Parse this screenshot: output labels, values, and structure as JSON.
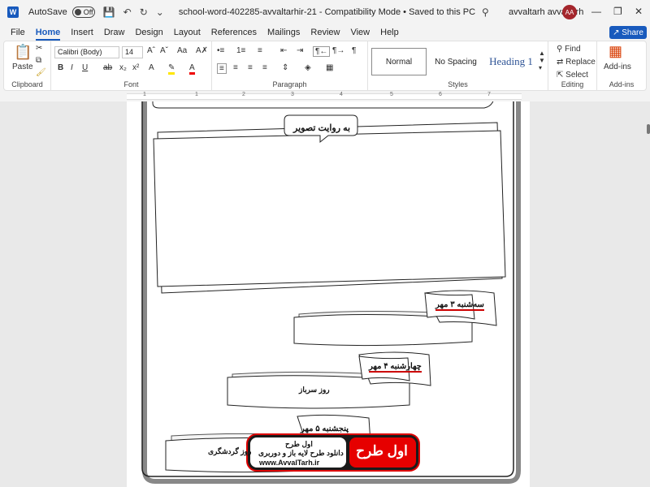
{
  "titlebar": {
    "app_icon": "W",
    "autosave_label": "AutoSave",
    "toggle_state": "Off",
    "doc_title": "school-word-402285-avvaltarhir-21  -  Compatibility Mode  •  Saved to this PC",
    "user_name": "avvaltarh avvaltarh",
    "user_initials": "AA"
  },
  "menu": {
    "items": [
      "File",
      "Home",
      "Insert",
      "Draw",
      "Design",
      "Layout",
      "References",
      "Mailings",
      "Review",
      "View",
      "Help"
    ],
    "active": "Home",
    "share_label": "Share"
  },
  "ribbon": {
    "clipboard": {
      "paste_label": "Paste",
      "group_label": "Clipboard"
    },
    "font": {
      "font_name": "Calibri (Body)",
      "font_size": "14",
      "group_label": "Font"
    },
    "paragraph": {
      "group_label": "Paragraph"
    },
    "styles": {
      "normal": "Normal",
      "no_spacing": "No Spacing",
      "heading1": "Heading 1",
      "group_label": "Styles"
    },
    "editing": {
      "find": "Find",
      "replace": "Replace",
      "select": "Select",
      "group_label": "Editing"
    },
    "addins": {
      "label": "Add-ins",
      "group_label": "Add-ins"
    }
  },
  "ruler": {
    "numbers": [
      "1",
      "1",
      "2",
      "3",
      "4",
      "5",
      "6",
      "7"
    ]
  },
  "document": {
    "picture_story_label": "به روایت تصویر",
    "day1_label": "سه‌شنبه ۳ مهر",
    "day1_text": "",
    "day2_label": "چهارشنبه ۴ مهر",
    "day2_text": "روز سرباز",
    "day3_label": "پنجشنبه ۵ مهر",
    "day3_text": "روز گردشگری"
  },
  "watermark": {
    "logo_text": "اول طرح",
    "line1": "اول طرح",
    "line2": "دانلود طرح لایه باز و دوربری",
    "line3": "www.AvvalTarh.ir"
  },
  "colors": {
    "accent": "#185abd",
    "avatar": "#a4262c"
  }
}
